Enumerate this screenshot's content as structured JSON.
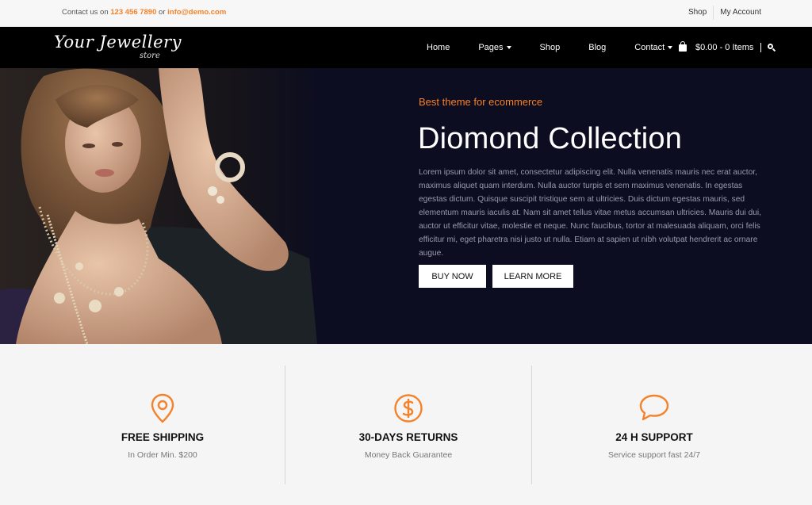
{
  "topbar": {
    "contact_prefix": "Contact us on",
    "phone": "123 456 7890",
    "or": "or",
    "email": "info@demo.com",
    "links": [
      "Shop",
      "My Account"
    ]
  },
  "logo": {
    "main": "Your Jewellery",
    "sub": "store"
  },
  "nav": {
    "items": [
      {
        "label": "Home",
        "dropdown": false
      },
      {
        "label": "Pages",
        "dropdown": true
      },
      {
        "label": "Shop",
        "dropdown": false
      },
      {
        "label": "Blog",
        "dropdown": false
      },
      {
        "label": "Contact",
        "dropdown": true
      }
    ],
    "cart": "$0.00 - 0 Items",
    "icons": {
      "cart": "shopping-bag-icon",
      "search": "search-icon"
    }
  },
  "hero": {
    "tagline": "Best theme for ecommerce",
    "title": "Diomond Collection",
    "description": "Lorem ipsum dolor sit amet, consectetur adipiscing elit. Nulla venenatis mauris nec erat auctor, maximus aliquet quam interdum. Nulla auctor turpis et sem maximus venenatis. In egestas egestas dictum. Quisque suscipit tristique sem at ultricies. Duis dictum egestas mauris, sed elementum mauris iaculis at. Nam sit amet tellus vitae metus accumsan ultricies. Mauris dui dui, auctor ut efficitur vitae, molestie et neque. Nunc faucibus, tortor at malesuada aliquam, orci felis efficitur mi, eget pharetra nisi justo ut nulla. Etiam at sapien ut nibh volutpat hendrerit ac ornare augue.",
    "buy_label": "BUY NOW",
    "learn_label": "LEARN MORE"
  },
  "features": [
    {
      "icon": "map-pin-icon",
      "title": "FREE SHIPPING",
      "subtitle": "In Order Min. $200"
    },
    {
      "icon": "dollar-circle-icon",
      "title": "30-DAYS RETURNS",
      "subtitle": "Money Back Guarantee"
    },
    {
      "icon": "speech-bubble-icon",
      "title": "24 H SUPPORT",
      "subtitle": "Service support fast 24/7"
    }
  ],
  "colors": {
    "accent": "#f5822a",
    "nav_bg": "#000000",
    "hero_bg": "#0c0d20",
    "page_bg": "#f5f5f5"
  }
}
